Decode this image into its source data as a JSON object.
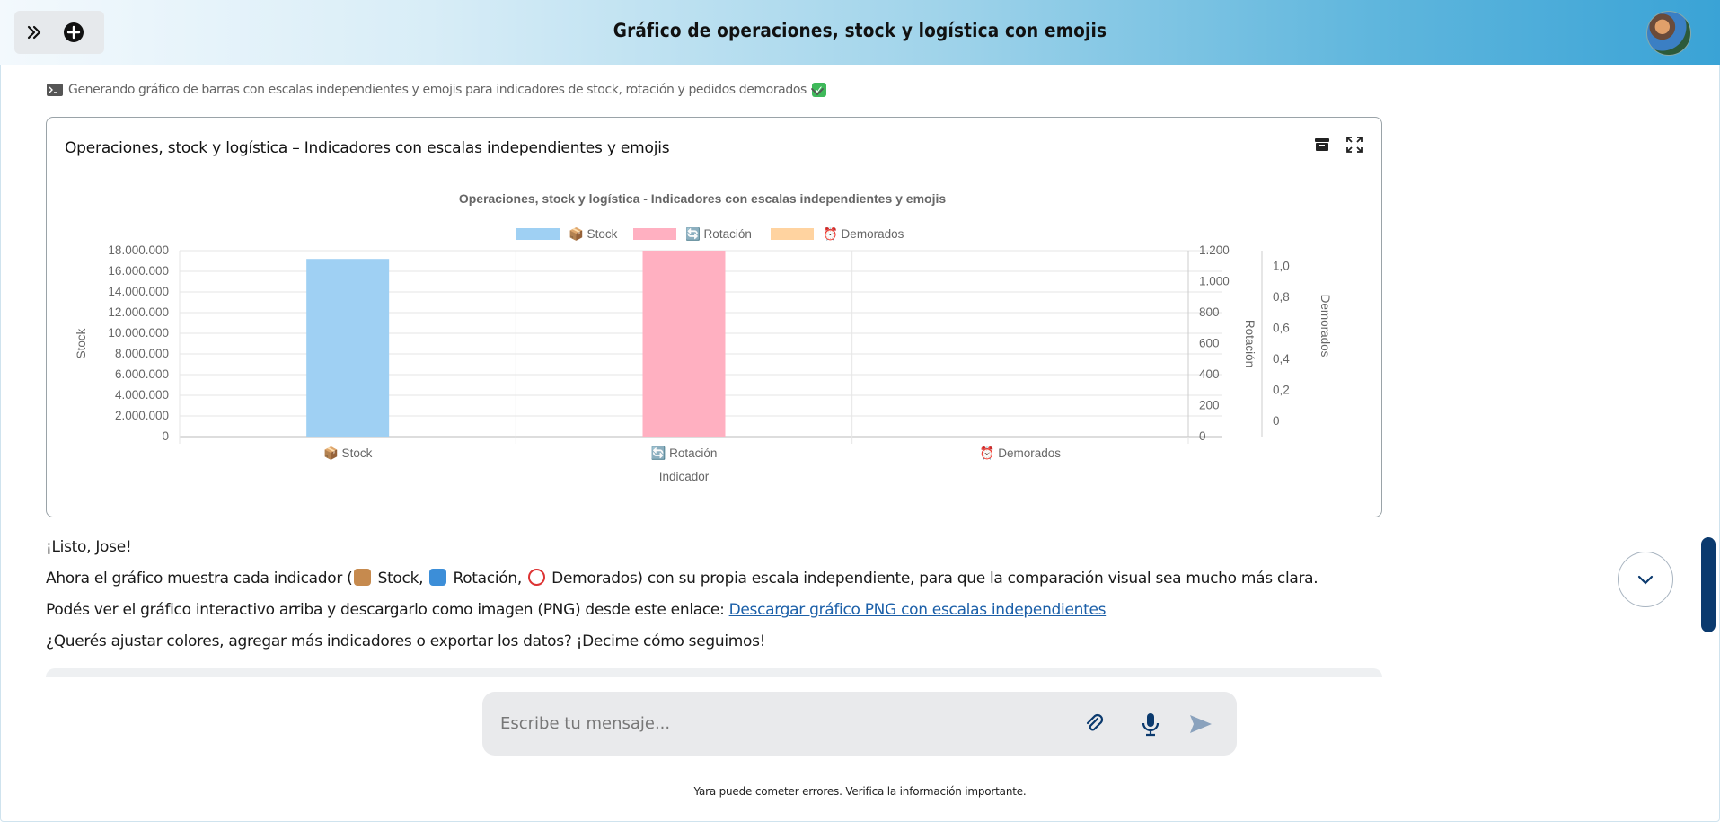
{
  "header": {
    "title": "Gráfico de operaciones, stock y logística con emojis"
  },
  "status": {
    "text": "Generando gráfico de barras con escalas independientes y emojis para indicadores de stock, rotación y pedidos demorados"
  },
  "card": {
    "title": "Operaciones, stock y logística – Indicadores con escalas independientes y emojis"
  },
  "chart_data": {
    "type": "bar",
    "title": "Operaciones, stock y logística - Indicadores con escalas independientes y emojis",
    "xlabel": "Indicador",
    "categories": [
      "📦 Stock",
      "🔄 Rotación",
      "⏰ Demorados"
    ],
    "legend_position": "top",
    "grid": true,
    "series": [
      {
        "name": "📦 Stock",
        "axis": "Stock",
        "color": "#9fd0f3",
        "values": [
          17200000,
          null,
          null
        ]
      },
      {
        "name": "🔄 Rotación",
        "axis": "Rotación",
        "color": "#ffb0c1",
        "values": [
          null,
          1200,
          null
        ]
      },
      {
        "name": "⏰ Demorados",
        "axis": "Demorados",
        "color": "#ffd3a0",
        "values": [
          null,
          null,
          0
        ]
      }
    ],
    "axes": {
      "Stock": {
        "label": "Stock",
        "ylim": [
          0,
          18000000
        ],
        "ticks": [
          "0",
          "2.000.000",
          "4.000.000",
          "6.000.000",
          "8.000.000",
          "10.000.000",
          "12.000.000",
          "14.000.000",
          "16.000.000",
          "18.000.000"
        ]
      },
      "Rotación": {
        "label": "Rotación",
        "ylim": [
          0,
          1200
        ],
        "ticks": [
          "0",
          "200",
          "400",
          "600",
          "800",
          "1.000",
          "1.200"
        ]
      },
      "Demorados": {
        "label": "Demorados",
        "ylim": [
          -0.1,
          1.1
        ],
        "ticks": [
          "0",
          "0,2",
          "0,4",
          "0,6",
          "0,8",
          "1,0"
        ]
      }
    }
  },
  "message": {
    "greeting": "¡Listo, Jose!",
    "line2_pre": "Ahora el gráfico muestra cada indicador (",
    "stock": "Stock,",
    "rotacion": "Rotación,",
    "line2_post": "Demorados) con su propia escala independiente, para que la comparación visual sea mucho más clara.",
    "line3_pre": "Podés ver el gráfico interactivo arriba y descargarlo como imagen (PNG) desde este enlace:",
    "link": "Descargar gráfico PNG con escalas independientes",
    "line4": "¿Querés ajustar colores, agregar más indicadores o exportar los datos? ¡Decime cómo seguimos!"
  },
  "input": {
    "placeholder": "Escribe tu mensaje..."
  },
  "footer": {
    "note": "Yara puede cometer errores. Verifica la información importante."
  },
  "icons": [
    "expand-sidebar-icon",
    "new-chat-icon",
    "terminal-icon",
    "check-icon",
    "chevron-down-icon",
    "archive-icon",
    "fullscreen-icon",
    "attach-icon",
    "microphone-icon",
    "send-icon",
    "scroll-down-icon"
  ]
}
